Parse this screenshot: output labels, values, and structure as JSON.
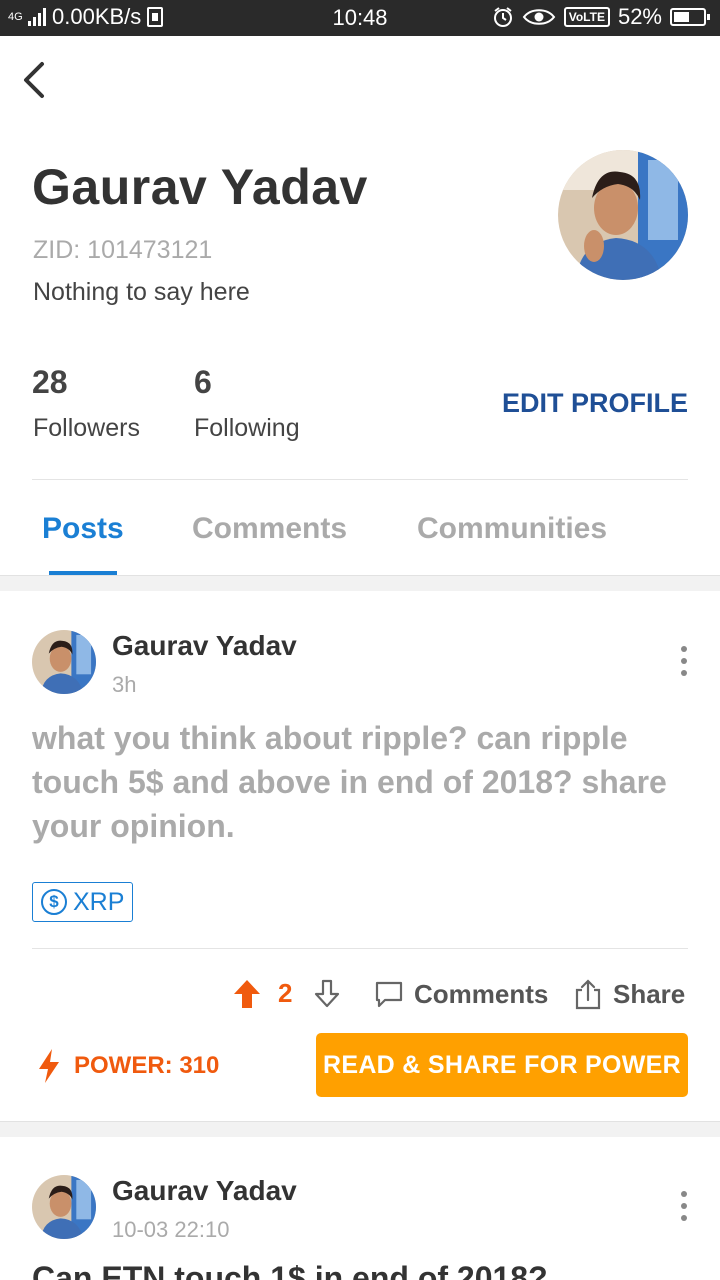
{
  "status_bar": {
    "network": "4G",
    "speed": "0.00KB/s",
    "time": "10:48",
    "volte": "VoLTE",
    "battery": "52%"
  },
  "profile": {
    "name": "Gaurav Yadav",
    "zid": "ZID: 101473121",
    "bio": "Nothing to say here",
    "followers_count": "28",
    "followers_label": "Followers",
    "following_count": "6",
    "following_label": "Following",
    "edit_label": "EDIT PROFILE"
  },
  "tabs": [
    {
      "label": "Posts",
      "active": true
    },
    {
      "label": "Comments",
      "active": false
    },
    {
      "label": "Communities",
      "active": false
    }
  ],
  "posts": [
    {
      "author": "Gaurav Yadav",
      "time": "3h",
      "body": "what you think about ripple? can ripple touch 5$ and above in end of 2018? share your opinion.",
      "tag": "XRP",
      "tag_icon": "$",
      "votes": "2",
      "comments_label": "Comments",
      "share_label": "Share",
      "power_label": "POWER: 310",
      "power_button": "READ & SHARE FOR POWER"
    },
    {
      "author": "Gaurav Yadav",
      "time": "10-03 22:10",
      "title": "Can ETN touch 1$ in end of 2018?"
    }
  ],
  "colors": {
    "accent_blue": "#1a7fd4",
    "edit_blue": "#1f4f96",
    "power_orange": "#f05a0e",
    "button_orange": "#ffa000"
  }
}
